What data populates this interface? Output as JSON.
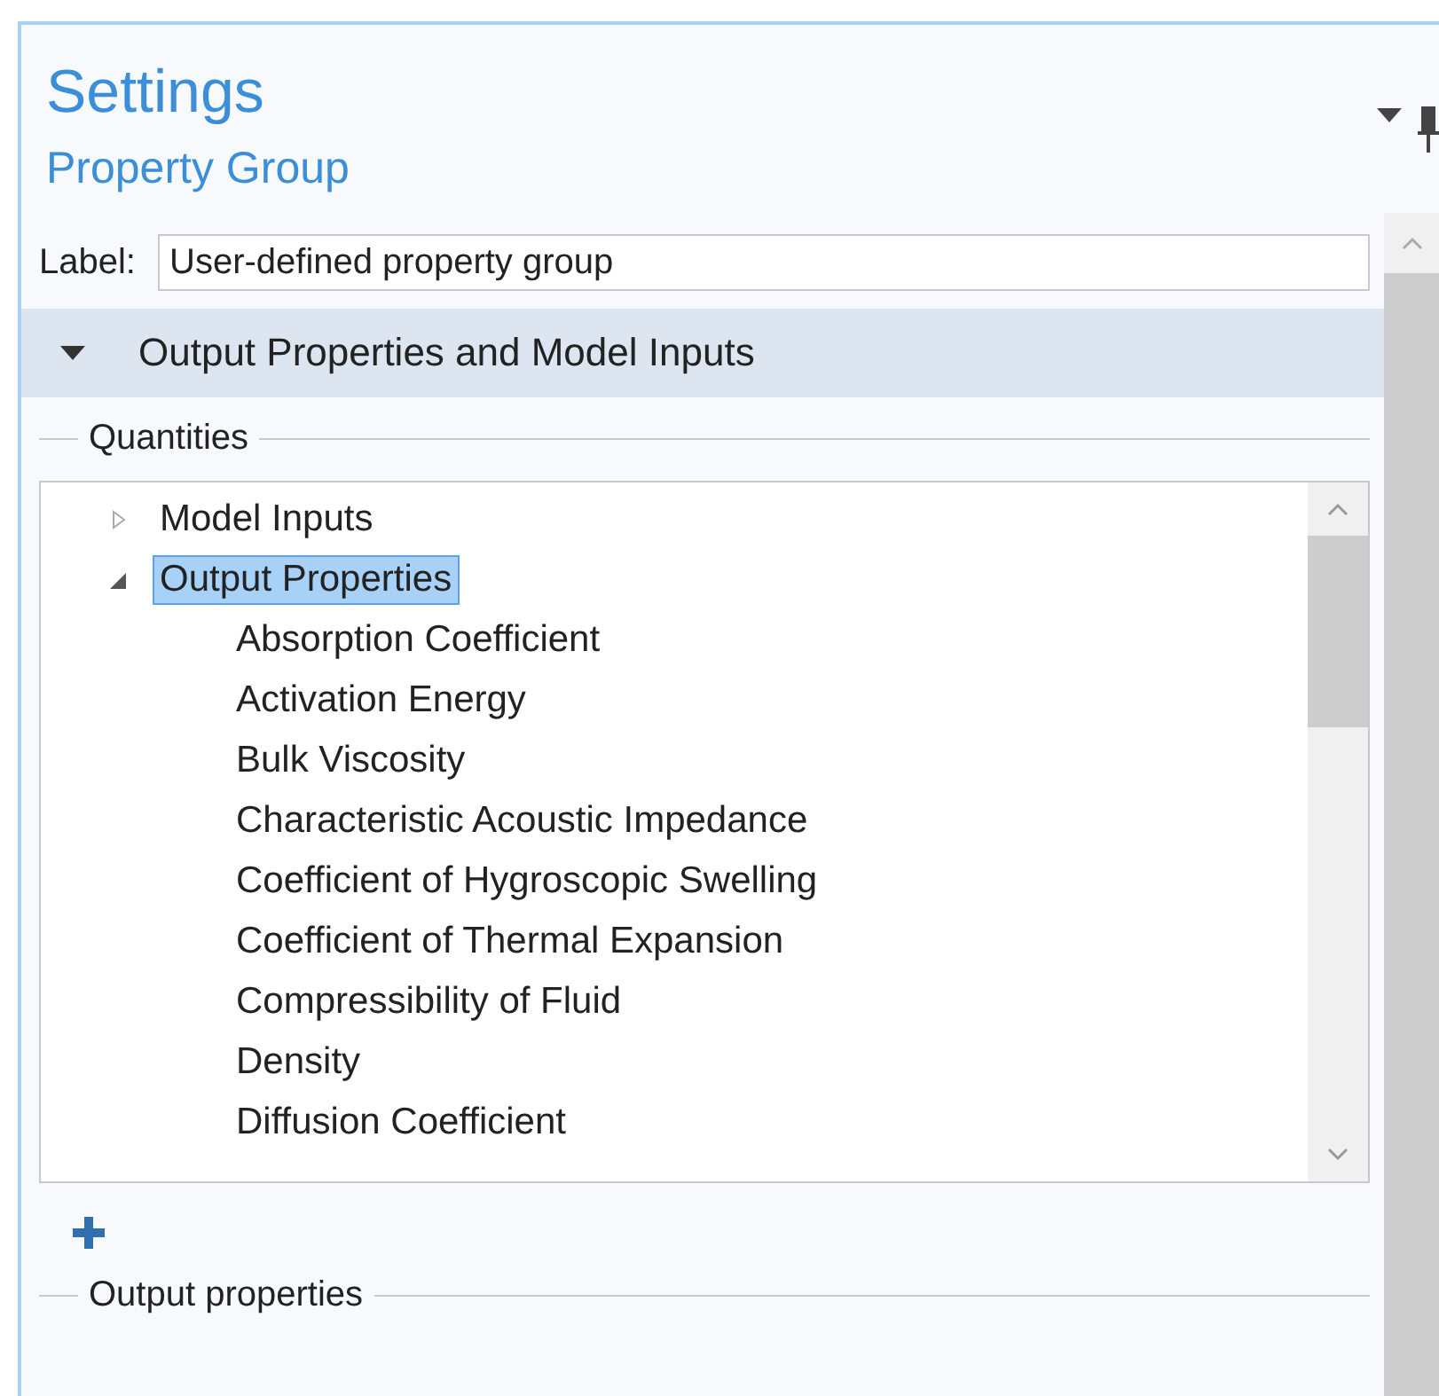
{
  "panel": {
    "title": "Settings",
    "subtitle": "Property Group"
  },
  "label_field": {
    "label": "Label:",
    "value": "User-defined property group"
  },
  "section": {
    "title": "Output Properties and Model Inputs",
    "expanded": true
  },
  "quantities": {
    "legend": "Quantities",
    "tree": [
      {
        "label": "Model Inputs",
        "expanded": false,
        "selected": false
      },
      {
        "label": "Output Properties",
        "expanded": true,
        "selected": true,
        "children": [
          {
            "label": "Absorption Coefficient",
            "selected": false
          },
          {
            "label": "Activation Energy",
            "selected": false
          },
          {
            "label": "Bulk Viscosity",
            "selected": false
          },
          {
            "label": "Characteristic Acoustic Impedance",
            "selected": false
          },
          {
            "label": "Coefficient of Hygroscopic Swelling",
            "selected": false
          },
          {
            "label": "Coefficient of Thermal Expansion",
            "selected": false
          },
          {
            "label": "Compressibility of Fluid",
            "selected": false
          },
          {
            "label": "Density",
            "selected": false
          },
          {
            "label": "Diffusion Coefficient",
            "selected": false
          }
        ]
      }
    ]
  },
  "output_properties": {
    "legend": "Output properties"
  }
}
